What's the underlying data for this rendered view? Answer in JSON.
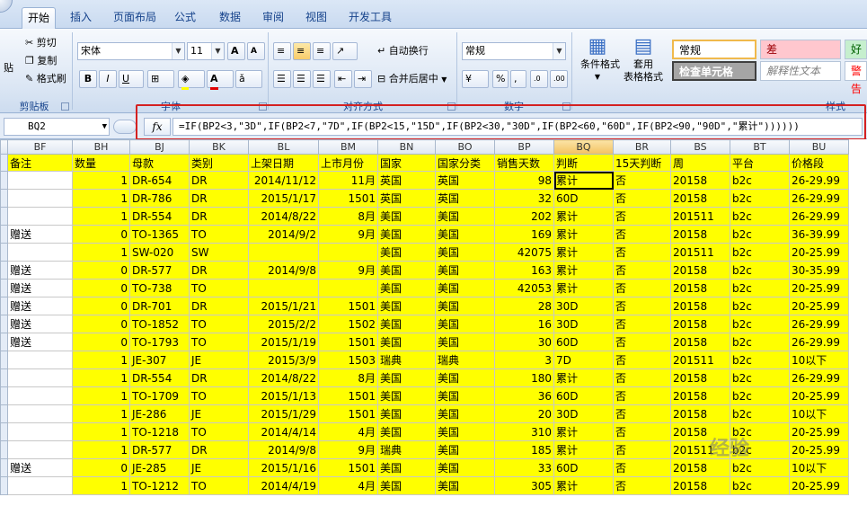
{
  "tabs": [
    "开始",
    "插入",
    "页面布局",
    "公式",
    "数据",
    "审阅",
    "视图",
    "开发工具"
  ],
  "active_tab": 0,
  "clipboard": {
    "paste_label": "贴",
    "cut_label": "剪切",
    "copy_label": "复制",
    "format_painter_label": "格式刷",
    "group_label": "剪贴板"
  },
  "font": {
    "name": "宋体",
    "size": "11",
    "bold": "B",
    "italic": "I",
    "underline": "U",
    "group_label": "字体"
  },
  "alignment": {
    "wrap_label": "自动换行",
    "merge_label": "合并后居中",
    "group_label": "对齐方式"
  },
  "number": {
    "format": "常规",
    "group_label": "数字"
  },
  "styles": {
    "conditional_label": "条件格式",
    "table_format_label1": "套用",
    "table_format_label2": "表格格式",
    "normal": "常规",
    "bad": "差",
    "good": "好",
    "check": "检查单元格",
    "explain": "解释性文本",
    "warn": "警告",
    "group_label": "样式"
  },
  "formula_bar": {
    "name_box": "BQ2",
    "fx": "fx",
    "formula": "=IF(BP2<3,\"3D\",IF(BP2<7,\"7D\",IF(BP2<15,\"15D\",IF(BP2<30,\"30D\",IF(BP2<60,\"60D\",IF(BP2<90,\"90D\",\"累计\"))))))"
  },
  "columns": [
    "BF",
    "BH",
    "BJ",
    "BK",
    "BL",
    "BM",
    "BN",
    "BO",
    "BP",
    "BQ",
    "BR",
    "BS",
    "BT",
    "BU"
  ],
  "header_row": [
    "备注",
    "数量",
    "母款",
    "类别",
    "上架日期",
    "上市月份",
    "国家",
    "国家分类",
    "销售天数",
    "判断",
    "15天判断",
    "周",
    "平台",
    "价格段"
  ],
  "rows": [
    [
      "",
      "1",
      "DR-654",
      "DR",
      "2014/11/12",
      "11月",
      "英国",
      "英国",
      "98",
      "累计",
      "否",
      "20158",
      "b2c",
      "26-29.99"
    ],
    [
      "",
      "1",
      "DR-786",
      "DR",
      "2015/1/17",
      "1501",
      "英国",
      "英国",
      "32",
      "60D",
      "否",
      "20158",
      "b2c",
      "26-29.99"
    ],
    [
      "",
      "1",
      "DR-554",
      "DR",
      "2014/8/22",
      "8月",
      "美国",
      "美国",
      "202",
      "累计",
      "否",
      "201511",
      "b2c",
      "26-29.99"
    ],
    [
      "赠送",
      "0",
      "TO-1365",
      "TO",
      "2014/9/2",
      "9月",
      "美国",
      "美国",
      "169",
      "累计",
      "否",
      "20158",
      "b2c",
      "36-39.99"
    ],
    [
      "",
      "1",
      "SW-020",
      "SW",
      "",
      "",
      "美国",
      "美国",
      "42075",
      "累计",
      "否",
      "201511",
      "b2c",
      "20-25.99"
    ],
    [
      "赠送",
      "0",
      "DR-577",
      "DR",
      "2014/9/8",
      "9月",
      "美国",
      "美国",
      "163",
      "累计",
      "否",
      "20158",
      "b2c",
      "30-35.99"
    ],
    [
      "赠送",
      "0",
      "TO-738",
      "TO",
      "",
      "",
      "美国",
      "美国",
      "42053",
      "累计",
      "否",
      "20158",
      "b2c",
      "20-25.99"
    ],
    [
      "赠送",
      "0",
      "DR-701",
      "DR",
      "2015/1/21",
      "1501",
      "美国",
      "美国",
      "28",
      "30D",
      "否",
      "20158",
      "b2c",
      "20-25.99"
    ],
    [
      "赠送",
      "0",
      "TO-1852",
      "TO",
      "2015/2/2",
      "1502",
      "美国",
      "美国",
      "16",
      "30D",
      "否",
      "20158",
      "b2c",
      "26-29.99"
    ],
    [
      "赠送",
      "0",
      "TO-1793",
      "TO",
      "2015/1/19",
      "1501",
      "美国",
      "美国",
      "30",
      "60D",
      "否",
      "20158",
      "b2c",
      "26-29.99"
    ],
    [
      "",
      "1",
      "JE-307",
      "JE",
      "2015/3/9",
      "1503",
      "瑞典",
      "瑞典",
      "3",
      "7D",
      "否",
      "201511",
      "b2c",
      "10以下"
    ],
    [
      "",
      "1",
      "DR-554",
      "DR",
      "2014/8/22",
      "8月",
      "美国",
      "美国",
      "180",
      "累计",
      "否",
      "20158",
      "b2c",
      "26-29.99"
    ],
    [
      "",
      "1",
      "TO-1709",
      "TO",
      "2015/1/13",
      "1501",
      "美国",
      "美国",
      "36",
      "60D",
      "否",
      "20158",
      "b2c",
      "20-25.99"
    ],
    [
      "",
      "1",
      "JE-286",
      "JE",
      "2015/1/29",
      "1501",
      "美国",
      "美国",
      "20",
      "30D",
      "否",
      "20158",
      "b2c",
      "10以下"
    ],
    [
      "",
      "1",
      "TO-1218",
      "TO",
      "2014/4/14",
      "4月",
      "美国",
      "美国",
      "310",
      "累计",
      "否",
      "20158",
      "b2c",
      "20-25.99"
    ],
    [
      "",
      "1",
      "DR-577",
      "DR",
      "2014/9/8",
      "9月",
      "瑞典",
      "美国",
      "185",
      "累计",
      "否",
      "201511",
      "b2c",
      "20-25.99"
    ],
    [
      "赠送",
      "0",
      "JE-285",
      "JE",
      "2015/1/16",
      "1501",
      "美国",
      "美国",
      "33",
      "60D",
      "否",
      "20158",
      "b2c",
      "10以下"
    ],
    [
      "",
      "1",
      "TO-1212",
      "TO",
      "2014/4/19",
      "4月",
      "美国",
      "美国",
      "305",
      "累计",
      "否",
      "20158",
      "b2c",
      "20-25.99"
    ]
  ],
  "watermark": "经验"
}
